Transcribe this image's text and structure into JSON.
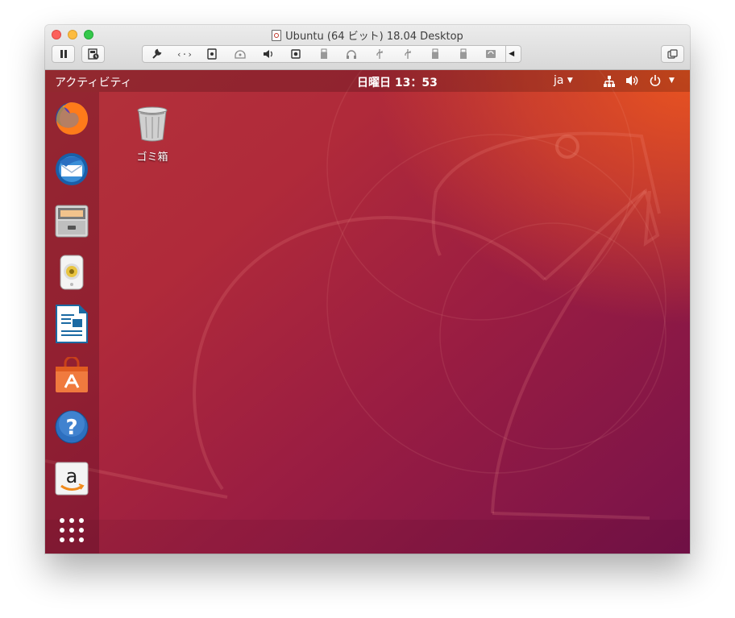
{
  "window": {
    "title": "Ubuntu (64 ビット) 18.04 Desktop"
  },
  "toolbar": {
    "items": [
      "wrench-icon",
      "code-arrows-icon",
      "disk-icon",
      "optical-drive-icon",
      "speaker-icon",
      "camera-icon",
      "usb-device-icon",
      "headphones-icon",
      "usb-icon",
      "usb-icon",
      "usb-device-icon",
      "usb-device-icon",
      "refresh-icon"
    ]
  },
  "topbar": {
    "activities": "アクティビティ",
    "clock": "日曜日 13：53",
    "keyboard": "ja"
  },
  "dock": {
    "apps": [
      {
        "name": "firefox",
        "icon": "firefox-icon"
      },
      {
        "name": "thunderbird",
        "icon": "thunderbird-icon"
      },
      {
        "name": "files",
        "icon": "file-cabinet-icon"
      },
      {
        "name": "rhythmbox",
        "icon": "speaker-icon"
      },
      {
        "name": "libreoffice-writer",
        "icon": "document-icon"
      },
      {
        "name": "software",
        "icon": "shopping-bag-icon"
      },
      {
        "name": "help",
        "icon": "question-icon"
      },
      {
        "name": "amazon",
        "icon": "amazon-icon"
      }
    ]
  },
  "desktop": {
    "trash_label": "ゴミ箱"
  },
  "colors": {
    "ubuntu_orange": "#e95420",
    "aubergine": "#77124a"
  }
}
